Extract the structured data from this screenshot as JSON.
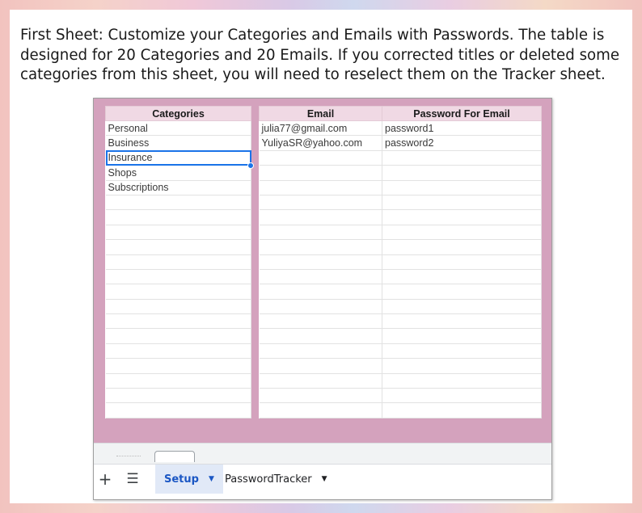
{
  "instructions": "First Sheet: Customize your Categories and Emails with Passwords. The table is designed for 20 Categories and 20 Emails. If you corrected titles or deleted some categories from this sheet, you will need to reselect them on the Tracker sheet.",
  "categories_table": {
    "header": "Categories",
    "rows": [
      "Personal",
      "Business",
      "Insurance",
      "Shops",
      "Subscriptions",
      "",
      "",
      "",
      "",
      "",
      "",
      "",
      "",
      "",
      "",
      "",
      "",
      "",
      "",
      ""
    ]
  },
  "emails_table": {
    "headers": [
      "Email",
      "Password For Email"
    ],
    "rows": [
      [
        "julia77@gmail.com",
        "password1"
      ],
      [
        "YuliyaSR@yahoo.com",
        "password2"
      ],
      [
        "",
        ""
      ],
      [
        "",
        ""
      ],
      [
        "",
        ""
      ],
      [
        "",
        ""
      ],
      [
        "",
        ""
      ],
      [
        "",
        ""
      ],
      [
        "",
        ""
      ],
      [
        "",
        ""
      ],
      [
        "",
        ""
      ],
      [
        "",
        ""
      ],
      [
        "",
        ""
      ],
      [
        "",
        ""
      ],
      [
        "",
        ""
      ],
      [
        "",
        ""
      ],
      [
        "",
        ""
      ],
      [
        "",
        ""
      ],
      [
        "",
        ""
      ],
      [
        "",
        ""
      ]
    ]
  },
  "selected_cell": "Insurance",
  "tabbar": {
    "add_icon": "plus-icon",
    "list_icon": "list-icon",
    "tabs": [
      {
        "label": "Setup",
        "active": true
      },
      {
        "label": "PasswordTracker",
        "active": false
      }
    ]
  },
  "colors": {
    "accent": "#1a73e8",
    "frame_pink": "#d4a2bd",
    "header_pink": "#f0d9e4",
    "active_tab_bg": "#e1e9f7",
    "active_tab_text": "#1b57c4"
  }
}
